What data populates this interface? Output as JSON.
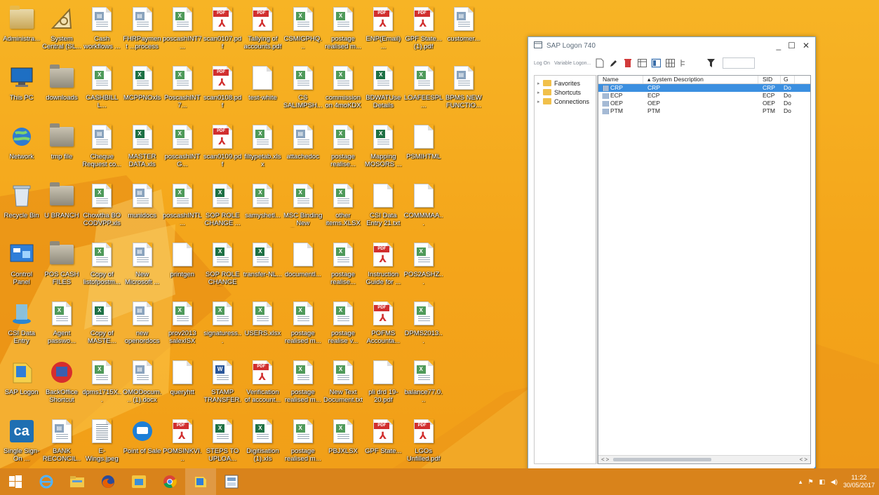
{
  "desktop": {
    "icons": [
      {
        "label": "Administra...",
        "type": "user-folder"
      },
      {
        "label": "System Central (SL...",
        "type": "drafting"
      },
      {
        "label": "Cash workflows ...",
        "type": "doc"
      },
      {
        "label": "FHRPayment ...process",
        "type": "doc"
      },
      {
        "label": "poscashINT7...",
        "type": "xls"
      },
      {
        "label": "scan0107.pdf",
        "type": "pdf"
      },
      {
        "label": "Tallying of accounts.pdf",
        "type": "pdf"
      },
      {
        "label": "CSMIGPHQ...",
        "type": "xls"
      },
      {
        "label": "postage realised m...",
        "type": "xls"
      },
      {
        "label": "ENP(Email) ...",
        "type": "pdf"
      },
      {
        "label": "GPF State... (1).pdf",
        "type": "pdf"
      },
      {
        "label": "customer...",
        "type": "doc"
      },
      {
        "label": "This PC",
        "type": "computer"
      },
      {
        "label": "downloads",
        "type": "folder-dark"
      },
      {
        "label": "CASHBILL L...",
        "type": "xls"
      },
      {
        "label": "MCPPNOxls",
        "type": "xlsx"
      },
      {
        "label": "PoscashINT7...",
        "type": "xls"
      },
      {
        "label": "scan0108.pdf",
        "type": "pdf"
      },
      {
        "label": "test-white",
        "type": "blank"
      },
      {
        "label": "CS SALIMPSH...",
        "type": "xls"
      },
      {
        "label": "commission on 4moKDX",
        "type": "xls"
      },
      {
        "label": "BDWATUse Details",
        "type": "xlsx"
      },
      {
        "label": "LOAFEESPL...",
        "type": "xls"
      },
      {
        "label": "BPMS NEW FUNCTIO...",
        "type": "doc"
      },
      {
        "label": "Network",
        "type": "network"
      },
      {
        "label": "tmp file",
        "type": "folder-dark"
      },
      {
        "label": "Cheque Request co...",
        "type": "doc"
      },
      {
        "label": "MASTER DATA.xls",
        "type": "xlsx"
      },
      {
        "label": "poscashINTG...",
        "type": "xls"
      },
      {
        "label": "scan0109.pdf",
        "type": "pdf"
      },
      {
        "label": "filtypetab.xlsx",
        "type": "xls"
      },
      {
        "label": "attachedoc",
        "type": "doc"
      },
      {
        "label": "postage realise...",
        "type": "xls"
      },
      {
        "label": "Mapping MOSORS ...",
        "type": "xlsx"
      },
      {
        "label": "PSMIHTML",
        "type": "blank"
      },
      {
        "label": "",
        "type": "none"
      },
      {
        "label": "Recycle Bin",
        "type": "recycle"
      },
      {
        "label": "U BRANCH",
        "type": "folder-dark"
      },
      {
        "label": "Chowtha BO CODVPP.xlsx",
        "type": "xls"
      },
      {
        "label": "munidocs",
        "type": "doc"
      },
      {
        "label": "poscashINTL...",
        "type": "xls"
      },
      {
        "label": "SOP ROLE CHANGE ...",
        "type": "xlsx"
      },
      {
        "label": "samyshetl...",
        "type": "xls"
      },
      {
        "label": "MSC Binding New Forma...",
        "type": "xls"
      },
      {
        "label": "other items.XLSX",
        "type": "xls"
      },
      {
        "label": "CSI Data Entry 21.txt",
        "type": "blank"
      },
      {
        "label": "COMMMAA...",
        "type": "blank"
      },
      {
        "label": "",
        "type": "none"
      },
      {
        "label": "Control Panel",
        "type": "control"
      },
      {
        "label": "POS CASH FILES",
        "type": "folder-dark"
      },
      {
        "label": "Copy of listofpostm...",
        "type": "xls"
      },
      {
        "label": "New Microsoft ...",
        "type": "doc"
      },
      {
        "label": "printgen",
        "type": "blank"
      },
      {
        "label": "SOP ROLE CHANGE FI...",
        "type": "xlsx"
      },
      {
        "label": "transfer-NL...",
        "type": "xlsx"
      },
      {
        "label": "documentl...",
        "type": "blank"
      },
      {
        "label": "postage realise...",
        "type": "xls"
      },
      {
        "label": "Instruction Guide for ...",
        "type": "pdf"
      },
      {
        "label": "POS2ASHZ...",
        "type": "xls"
      },
      {
        "label": "",
        "type": "none"
      },
      {
        "label": "CSI Data Entry",
        "type": "csi"
      },
      {
        "label": "Agent passwo...",
        "type": "xls"
      },
      {
        "label": "Copy of MASTE...",
        "type": "xlsx"
      },
      {
        "label": "new openordocs",
        "type": "doc"
      },
      {
        "label": "prov2013 salexlSX",
        "type": "xls"
      },
      {
        "label": "signaturess...",
        "type": "xls"
      },
      {
        "label": "USERS.xlsx",
        "type": "xls"
      },
      {
        "label": "postage realised m...",
        "type": "xls"
      },
      {
        "label": "postage realise v...",
        "type": "xls"
      },
      {
        "label": "POFMS Accounta...",
        "type": "pdf"
      },
      {
        "label": "DPMS2013...",
        "type": "xls"
      },
      {
        "label": "",
        "type": "none"
      },
      {
        "label": "SAP Logon",
        "type": "sap"
      },
      {
        "label": "BackOffice Shortcut",
        "type": "backoffice"
      },
      {
        "label": "dpms1715X...",
        "type": "xls"
      },
      {
        "label": "OMODocum... (1).docx",
        "type": "doc"
      },
      {
        "label": "queryhtt",
        "type": "blank"
      },
      {
        "label": "STAMP TRANSFER...",
        "type": "word"
      },
      {
        "label": "Verification of account...",
        "type": "pdf"
      },
      {
        "label": "postage realised m...",
        "type": "xls"
      },
      {
        "label": "New Text Document.txt",
        "type": "xls"
      },
      {
        "label": "pli drd 19-20.pdf",
        "type": "blank"
      },
      {
        "label": "balance77.0...",
        "type": "xls"
      },
      {
        "label": "",
        "type": "none"
      },
      {
        "label": "Single Sign-On ...",
        "type": "ca"
      },
      {
        "label": "BANK RECONCIL...",
        "type": "doc"
      },
      {
        "label": "E-Wings.jpeg",
        "type": "image"
      },
      {
        "label": "Point of Sale",
        "type": "pos"
      },
      {
        "label": "POMSINKVI...",
        "type": "pdf"
      },
      {
        "label": "STEPS TO UPLOA...",
        "type": "xlsx"
      },
      {
        "label": "Digitisation (1).xls",
        "type": "xlsx"
      },
      {
        "label": "postage realised m...",
        "type": "xls"
      },
      {
        "label": "PBJXLSX",
        "type": "xls"
      },
      {
        "label": "GPF State...",
        "type": "pdf"
      },
      {
        "label": "LGOs Unfilled.pdf",
        "type": "pdf"
      },
      {
        "label": "",
        "type": "none"
      }
    ]
  },
  "sap": {
    "title": "SAP Logon 740",
    "toolbar": {
      "logon": "Log On",
      "variable_logon": "Variable Logon..."
    },
    "tree": [
      {
        "label": "Favorites"
      },
      {
        "label": "Shortcuts"
      },
      {
        "label": "Connections"
      }
    ],
    "columns": {
      "name": "Name",
      "desc": "System Description",
      "sid": "SID",
      "g": "G"
    },
    "rows": [
      {
        "name": "CRP",
        "desc": "CRP",
        "sid": "CRP",
        "g": "Do",
        "selected": true
      },
      {
        "name": "ECP",
        "desc": "ECP",
        "sid": "ECP",
        "g": "Do",
        "selected": false
      },
      {
        "name": "OEP",
        "desc": "OEP",
        "sid": "OEP",
        "g": "Do",
        "selected": false
      },
      {
        "name": "PTM",
        "desc": "PTM",
        "sid": "PTM",
        "g": "Do",
        "selected": false
      }
    ],
    "accent": "#3b8fe0"
  },
  "taskbar": {
    "items": [
      "start-icon",
      "internet-explorer-icon",
      "file-explorer-icon",
      "firefox-icon",
      "folder-app-icon",
      "chrome-icon",
      "sap-logon-icon",
      "pos-app-icon"
    ],
    "clock_time": "11:22",
    "clock_date": "30/05/2017"
  }
}
